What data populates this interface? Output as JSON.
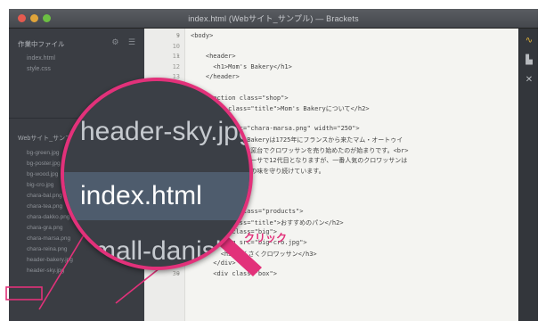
{
  "window": {
    "title": "index.html (Webサイト_サンプル) — Brackets"
  },
  "sidebar": {
    "header": "作業中ファイル",
    "header_icons": [
      "⚙",
      "☰"
    ],
    "open_files": [
      "index.html",
      "style.css"
    ],
    "folder": "Webサイト_サンプル ▾",
    "files": [
      "bg-green.jpg",
      "bg-poster.jpg",
      "bg-wood.jpg",
      "big-cro.jpg",
      "chara-bal.png",
      "chara-tea.png",
      "chara-dakko.png",
      "chara-gra.png",
      "chara-marsa.png",
      "chara-reina.png",
      "header-bakery.jpg",
      "header-sky.jpg"
    ]
  },
  "editor": {
    "lines": [
      {
        "n": "9",
        "fold": "▾",
        "code": "<body>"
      },
      {
        "n": "10",
        "fold": "",
        "code": ""
      },
      {
        "n": "11",
        "fold": "▾",
        "code": "    <header>"
      },
      {
        "n": "12",
        "fold": "",
        "code": "      <h1>Mom's Bakery</h1>"
      },
      {
        "n": "13",
        "fold": "",
        "code": "    </header>"
      },
      {
        "n": "14",
        "fold": "",
        "code": ""
      },
      {
        "n": "15",
        "fold": "▾",
        "code": "    <section class=\"shop\">"
      },
      {
        "n": "16",
        "fold": "",
        "code": "      <h2 class=\"title\">Mom's Bakeryについて</h2>"
      },
      {
        "n": "17",
        "fold": "",
        "code": ""
      },
      {
        "n": "18",
        "fold": "",
        "code": "      <img src=\"chara-marsa.png\" width=\"250\">"
      },
      {
        "n": "19",
        "fold": "",
        "code": "      <p>Mom's Bakeryは1725年にフランスから来たマム・オートゥイ"
      },
      {
        "n": "20",
        "fold": "",
        "code": "      ユ氏が小さな窯台でクロワッサンを売り始めたのが始まりです。<br>"
      },
      {
        "n": "21",
        "fold": "",
        "code": "      現在はマムマーサで12代目となりますが、一番人気のクロワッサンは"
      },
      {
        "n": "22",
        "fold": "",
        "code": "      変わらぬ伝統の味を守り続けています。"
      },
      {
        "n": "23",
        "fold": "",
        "code": "      </p>"
      },
      {
        "n": "24",
        "fold": "",
        "code": "    </section>"
      },
      {
        "n": "25",
        "fold": "",
        "code": ""
      },
      {
        "n": "26",
        "fold": "▾",
        "code": "    <section class=\"products\">"
      },
      {
        "n": "27",
        "fold": "",
        "code": "      <h2 class=\"title\">おすすめのパン</h2>"
      },
      {
        "n": "28",
        "fold": "",
        "code": "      <div class=\"big\">"
      },
      {
        "n": "29",
        "fold": "",
        "code": "        <img src=\"big-cro.jpg\">"
      },
      {
        "n": "28",
        "fold": "",
        "code": "        <h3>さくさくクロワッサン</h3>"
      },
      {
        "n": "29",
        "fold": "",
        "code": "      </div>"
      },
      {
        "n": "30",
        "fold": "▾",
        "code": "      <div class=\"box\">"
      }
    ]
  },
  "magnifier": {
    "items": [
      "header-sky.jpg",
      "index.html",
      "small-danish.png"
    ],
    "selected_index": 1
  },
  "callout": {
    "label": "クリック",
    "color": "#e2317a"
  },
  "rightbar": {
    "icons": [
      "live-preview-icon",
      "extension-icon",
      "inspect-icon"
    ]
  }
}
